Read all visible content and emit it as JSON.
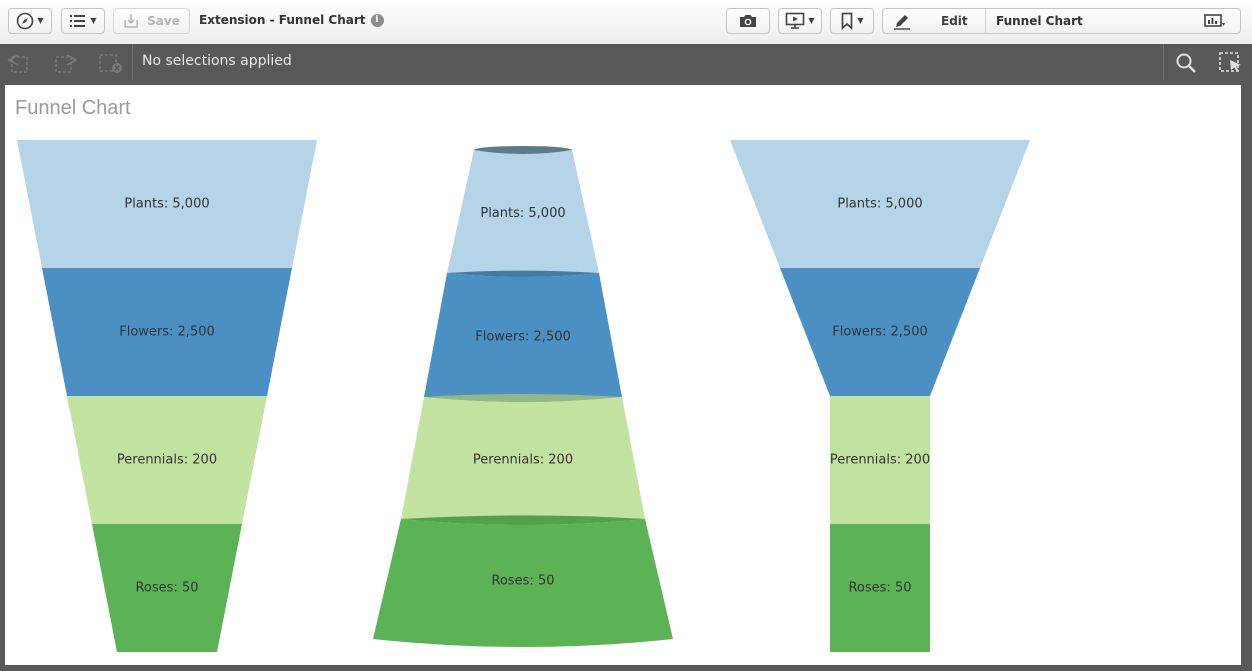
{
  "toolbar": {
    "navigation_icon": "compass-icon",
    "list_icon": "list-icon",
    "save_label": "Save",
    "app_title": "Extension - Funnel Chart",
    "snapshot_icon": "camera-icon",
    "present_icon": "presentation-icon",
    "bookmark_icon": "bookmark-icon",
    "edit_label": "Edit",
    "sheet_name": "Funnel Chart",
    "sheet_icon": "sheet-icon"
  },
  "selections": {
    "status_text": "No selections applied"
  },
  "sheet": {
    "title": "Funnel Chart"
  },
  "colors": {
    "plants": "#b5d4e8",
    "flowers": "#4a90c2",
    "perennials": "#c2e3a0",
    "roses": "#5cb356"
  },
  "chart_data": [
    {
      "type": "funnel",
      "shape": "trapezoid",
      "categories": [
        "Plants",
        "Flowers",
        "Perennials",
        "Roses"
      ],
      "values": [
        5000,
        2500,
        200,
        50
      ],
      "labels": [
        "Plants: 5,000",
        "Flowers: 2,500",
        "Perennials: 200",
        "Roses: 50"
      ]
    },
    {
      "type": "funnel",
      "shape": "cone",
      "categories": [
        "Plants",
        "Flowers",
        "Perennials",
        "Roses"
      ],
      "values": [
        5000,
        2500,
        200,
        50
      ],
      "labels": [
        "Plants: 5,000",
        "Flowers: 2,500",
        "Perennials: 200",
        "Roses: 50"
      ]
    },
    {
      "type": "funnel",
      "shape": "funnel",
      "categories": [
        "Plants",
        "Flowers",
        "Perennials",
        "Roses"
      ],
      "values": [
        5000,
        2500,
        200,
        50
      ],
      "labels": [
        "Plants: 5,000",
        "Flowers: 2,500",
        "Perennials: 200",
        "Roses: 50"
      ]
    }
  ]
}
